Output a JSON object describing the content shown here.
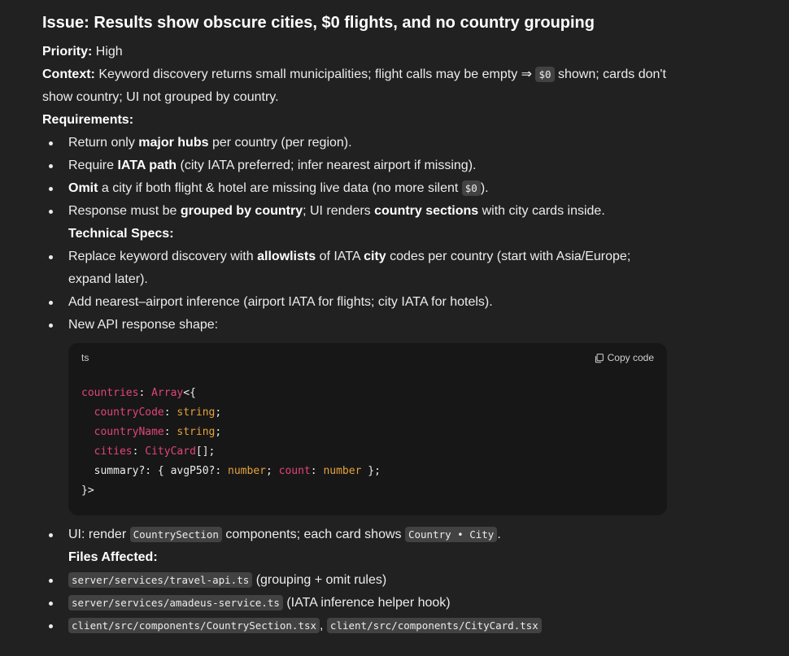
{
  "title": "Issue: Results show obscure cities, $0 flights, and no country grouping",
  "priority": {
    "label": "Priority:",
    "value": " High"
  },
  "context": {
    "label": "Context:",
    "text1": " Keyword discovery returns small municipalities; flight calls may be empty ⇒ ",
    "code": "$0",
    "text2": " shown; cards don't show country; UI not grouped by country."
  },
  "requirements_label": "Requirements:",
  "req": {
    "r1a": "Return only ",
    "r1b": "major hubs",
    "r1c": " per country (per region).",
    "r2a": "Require ",
    "r2b": "IATA path",
    "r2c": " (city IATA preferred; infer nearest airport if missing).",
    "r3a": "Omit",
    "r3b": " a city if both flight & hotel are missing live data (no more silent ",
    "r3code": "$0",
    "r3c": ").",
    "r4a": "Response must be ",
    "r4b": "grouped by country",
    "r4c": "; UI renders ",
    "r4d": "country sections",
    "r4e": " with city cards inside."
  },
  "tech_label": "Technical Specs:",
  "tech": {
    "t1a": "Replace keyword discovery with ",
    "t1b": "allowlists",
    "t1c": " of IATA ",
    "t1d": "city",
    "t1e": " codes per country (start with Asia/Europe; expand later).",
    "t2": "Add nearest–airport inference (airport IATA for flights; city IATA for hotels).",
    "t3": "New API response shape:"
  },
  "codeblock": {
    "lang": "ts",
    "copy_label": "Copy code",
    "l1a": "countries",
    "l1b": ": ",
    "l1c": "Array",
    "l1d": "<{",
    "l2a": "countryCode",
    "l2b": ": ",
    "l2c": "string",
    "l2d": ";",
    "l3a": "countryName",
    "l3b": ": ",
    "l3c": "string",
    "l3d": ";",
    "l4a": "cities",
    "l4b": ": ",
    "l4c": "CityCard",
    "l4d": "[];",
    "l5a": "summary?: { avgP50?: ",
    "l5b": "number",
    "l5c": "; ",
    "l5d": "count",
    "l5e": ": ",
    "l5f": "number",
    "l5g": " };",
    "l6": "}>"
  },
  "ui": {
    "a": "UI: render ",
    "code1": "CountrySection",
    "b": " components; each card shows ",
    "code2": "Country • City",
    "c": "."
  },
  "files_label": "Files Affected:",
  "files": {
    "f1code": "server/services/travel-api.ts",
    "f1": " (grouping + omit rules)",
    "f2code": "server/services/amadeus-service.ts",
    "f2": " (IATA inference helper hook)",
    "f3code1": "client/src/components/CountrySection.tsx",
    "f3sep": ", ",
    "f3code2": "client/src/components/CityCard.tsx"
  }
}
